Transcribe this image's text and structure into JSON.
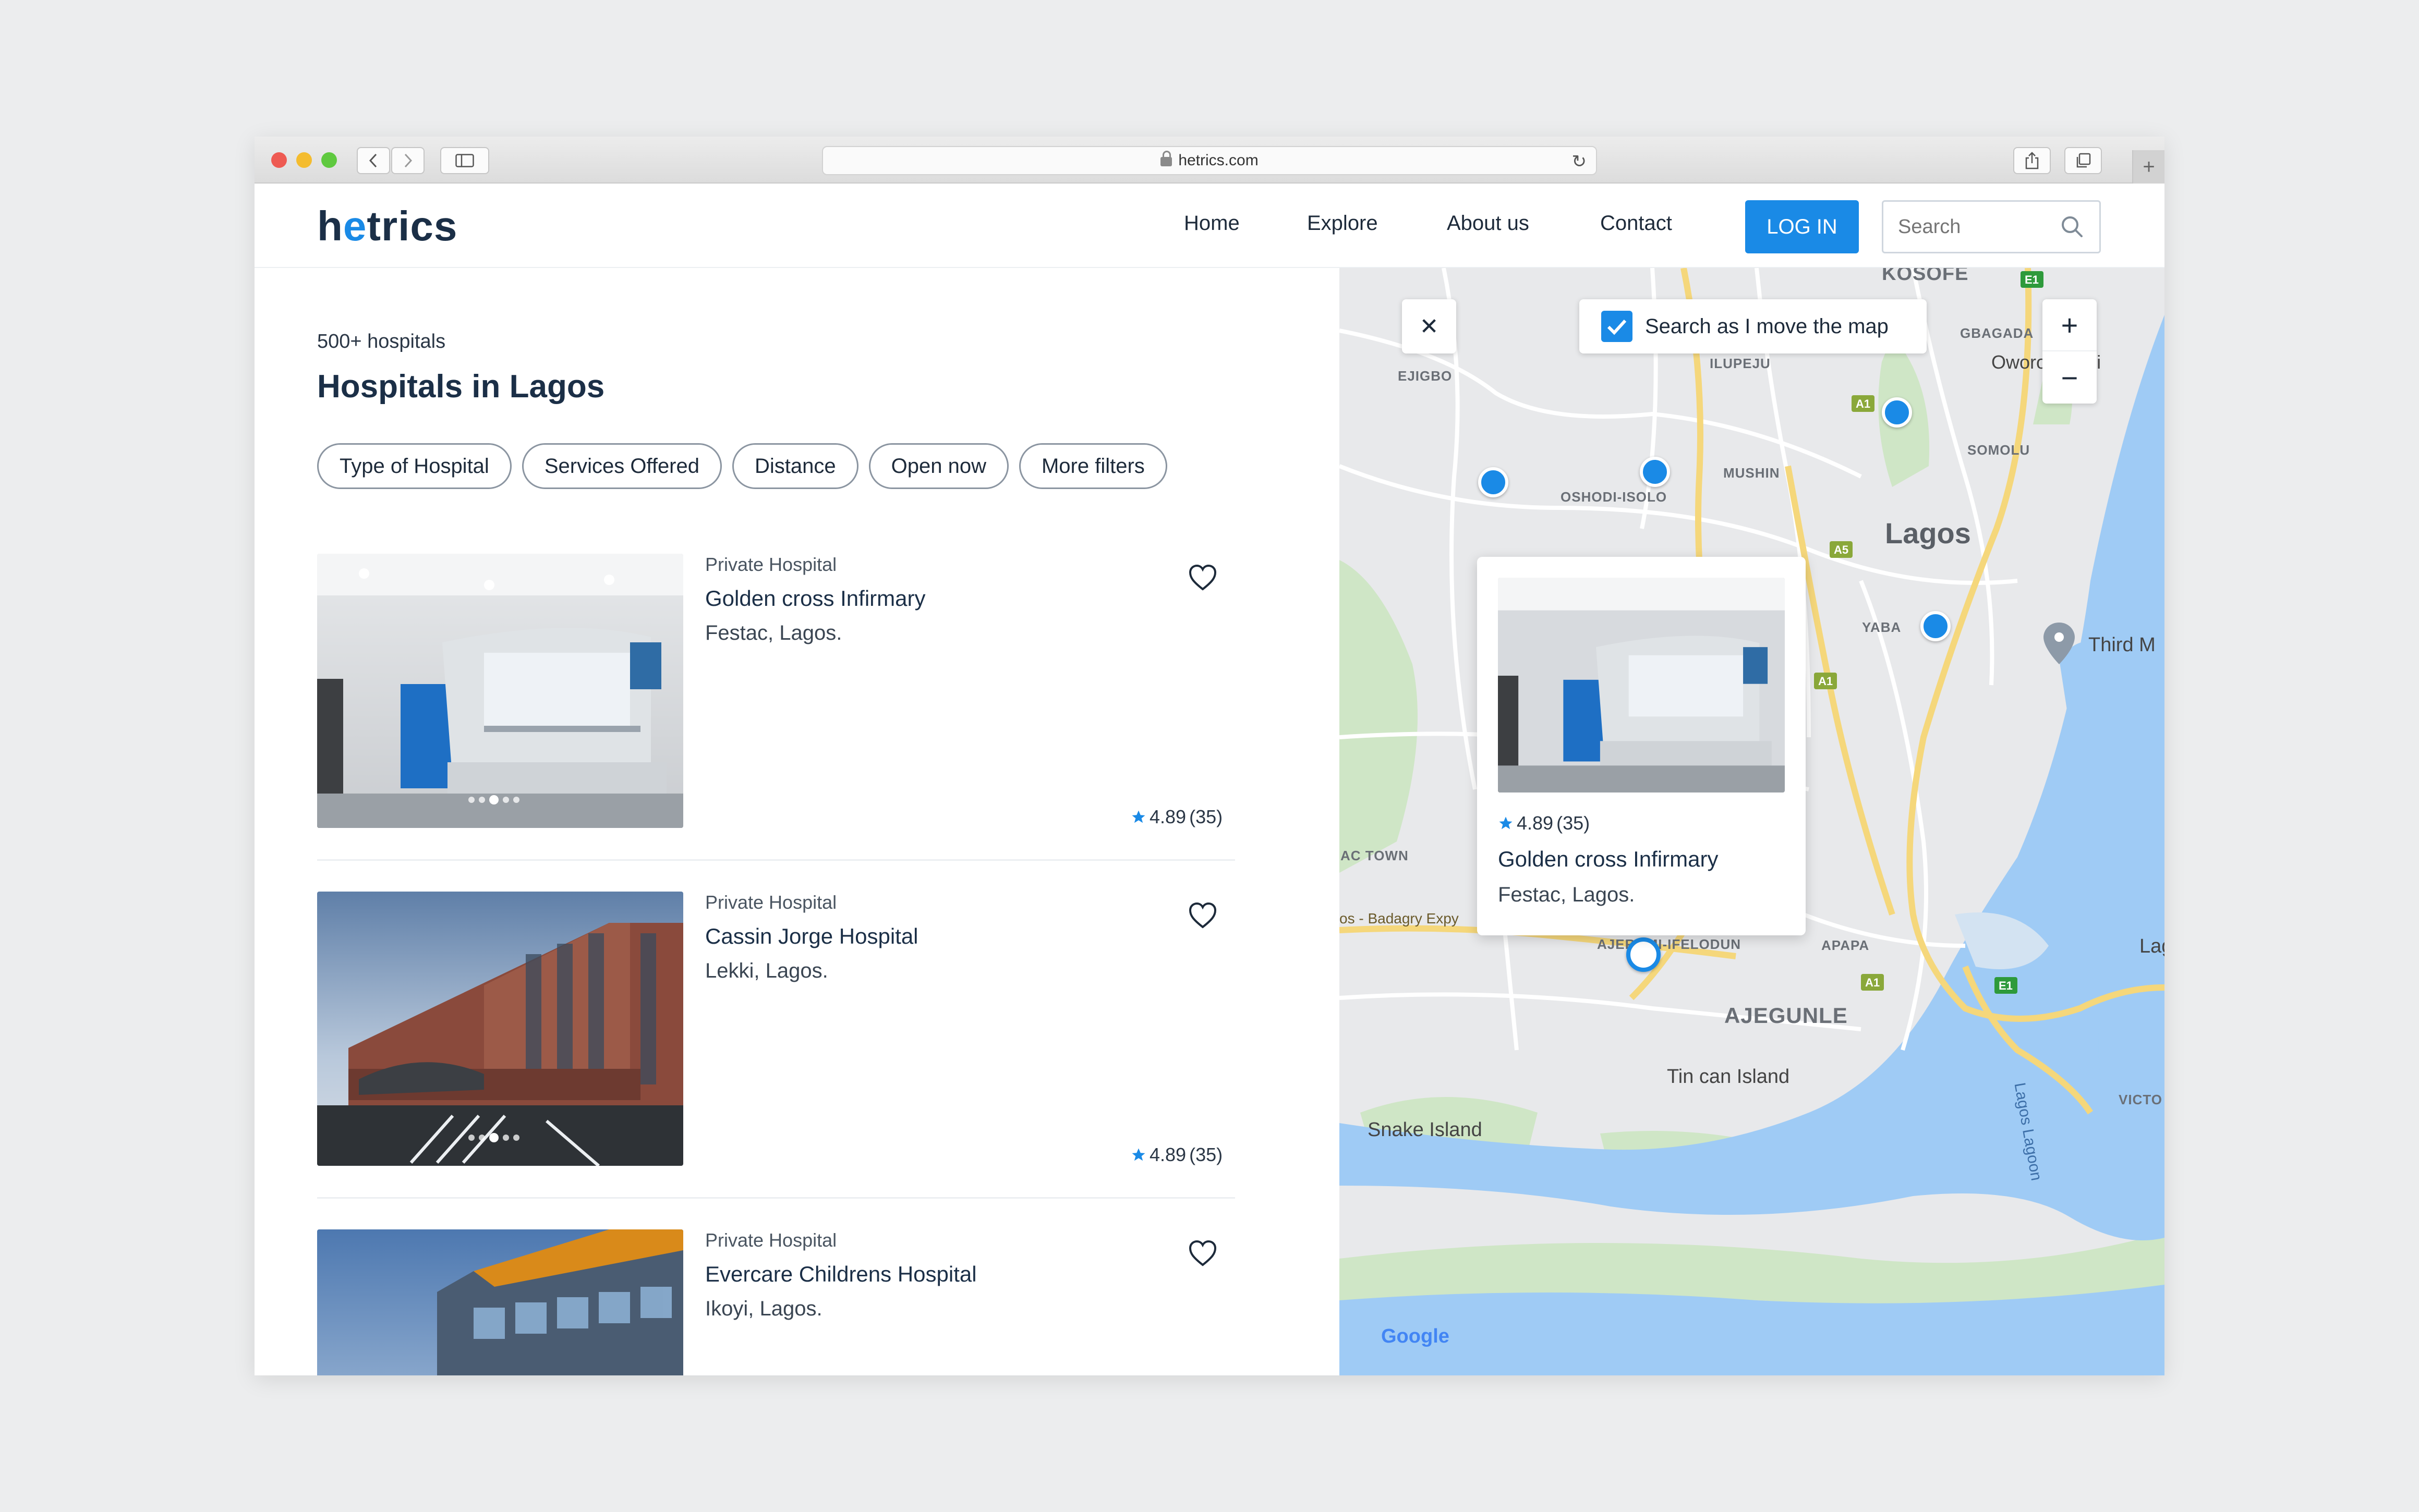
{
  "browser": {
    "url": "hetrics.com",
    "back_icon": "chevron-left-icon",
    "forward_icon": "chevron-right-icon"
  },
  "header": {
    "logo_prefix": "h",
    "logo_accent": "e",
    "logo_suffix": "trics",
    "nav": [
      "Home",
      "Explore",
      "About us",
      "Contact"
    ],
    "login_label": "LOG IN",
    "search_placeholder": "Search"
  },
  "listing": {
    "count": "500+ hospitals",
    "title": "Hospitals in Lagos",
    "filters": [
      "Type of Hospital",
      "Services Offered",
      "Distance",
      "Open now",
      "More filters"
    ],
    "hospitals": [
      {
        "type": "Private Hospital",
        "name": "Golden cross Infirmary",
        "location": "Festac, Lagos.",
        "rating": "4.89",
        "reviews": "(35)",
        "image_slide": 3
      },
      {
        "type": "Private Hospital",
        "name": "Cassin Jorge Hospital",
        "location": "Lekki, Lagos.",
        "rating": "4.89",
        "reviews": "(35)",
        "image_slide": 3
      },
      {
        "type": "Private Hospital",
        "name": "Evercare Childrens Hospital",
        "location": "Ikoyi, Lagos.",
        "rating": "4.89",
        "reviews": "(35)",
        "image_slide": 1
      }
    ]
  },
  "map": {
    "search_as_move_label": "Search as I move the map",
    "search_as_move_checked": true,
    "zoom_in": "+",
    "zoom_out": "−",
    "close": "✕",
    "labels": {
      "kosofe": "KOSOFE",
      "gbagada": "GBAGADA",
      "oworonshoki": "Oworonshoki",
      "ejigbo": "EJIGBO",
      "ilupeju": "ILUPEJU",
      "mushin": "MUSHIN",
      "oshodi": "OSHODI-ISOLO",
      "somolu": "SOMOLU",
      "lagos": "Lagos",
      "yaba": "YABA",
      "third_mainland": "Third M",
      "ac_town": "AC TOWN",
      "badagry": "os - Badagry Expy",
      "ajeromi": "AJEROMI-IFELODUN",
      "apapa": "APAPA",
      "ajegunle": "AJEGUNLE",
      "tin_can": "Tin can Island",
      "snake_island": "Snake Island",
      "lagos_lagoon": "Lagos Lagoon",
      "lag": "Lag",
      "victoria": "VICTO",
      "google": "Google",
      "roads": {
        "e1_top": "E1",
        "a1_top": "A1",
        "a5": "A5",
        "a1_mid": "A1",
        "a1_low": "A1",
        "e1_low": "E1"
      }
    },
    "popup": {
      "rating": "4.89",
      "reviews": "(35)",
      "name": "Golden cross Infirmary",
      "location": "Festac, Lagos."
    }
  }
}
